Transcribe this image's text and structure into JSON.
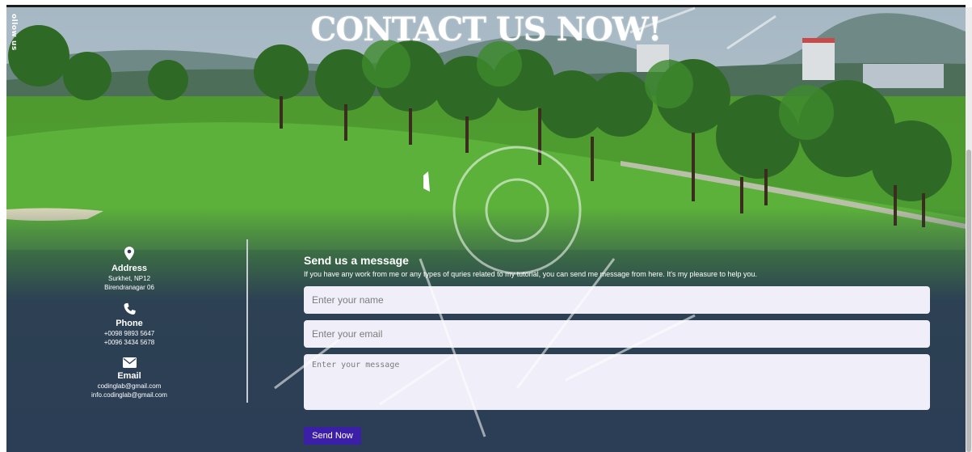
{
  "hero": {
    "title": "CONTACT US NOW!",
    "follow_label": "ollow us"
  },
  "contact_info": {
    "address": {
      "icon": "location-pin-icon",
      "title": "Address",
      "lines": [
        "Surkhet, NP12",
        "Birendranagar 06"
      ]
    },
    "phone": {
      "icon": "phone-icon",
      "title": "Phone",
      "lines": [
        "+0098 9893 5647",
        "+0096 3434 5678"
      ]
    },
    "email": {
      "icon": "envelope-icon",
      "title": "Email",
      "lines": [
        "codinglab@gmail.com",
        "info.codinglab@gmail.com"
      ]
    }
  },
  "form": {
    "title": "Send us a message",
    "subtitle": "If you have any work from me or any types of quries related to my tutorial, you can send me message from here. It's my pleasure to help you.",
    "name_placeholder": "Enter your name",
    "email_placeholder": "Enter your email",
    "message_placeholder": "Enter your message",
    "send_label": "Send Now"
  },
  "colors": {
    "overlay": "#2c3e55",
    "button": "#3b1fa6",
    "input_bg": "#f0eef8"
  }
}
